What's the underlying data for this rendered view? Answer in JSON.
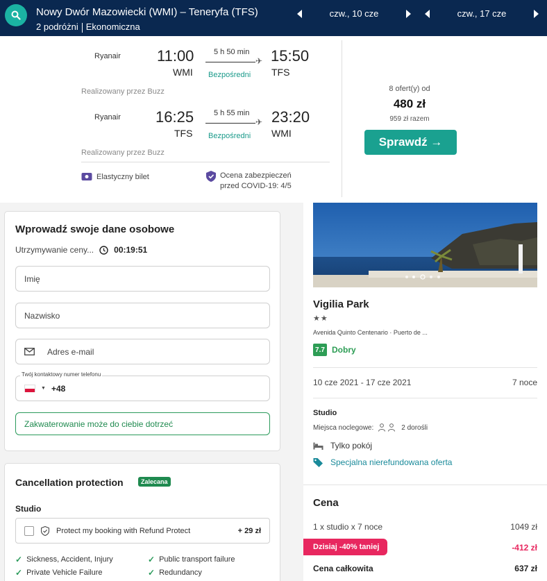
{
  "header": {
    "route": "Nowy Dwór Mazowiecki (WMI) – Teneryfa (TFS)",
    "travellers": "2 podróżni",
    "cabin": "Ekonomiczna",
    "depart_date": "czw., 10 cze",
    "return_date": "czw., 17 cze"
  },
  "flight": {
    "outbound": {
      "airline": "Ryanair",
      "dep_time": "11:00",
      "dep_code": "WMI",
      "duration": "5 h 50 min",
      "stops": "Bezpośredni",
      "arr_time": "15:50",
      "arr_code": "TFS",
      "operated": "Realizowany przez Buzz"
    },
    "inbound": {
      "airline": "Ryanair",
      "dep_time": "16:25",
      "dep_code": "TFS",
      "duration": "5 h 55 min",
      "stops": "Bezpośredni",
      "arr_time": "23:20",
      "arr_code": "WMI",
      "operated": "Realizowany przez Buzz"
    },
    "flexible": "Elastyczny bilet",
    "covid_line1": "Ocena zabezpieczeń",
    "covid_line2": "przed COVID-19: 4/5",
    "offers": "8 ofert(y) od",
    "price": "480 zł",
    "total": "959 zł razem",
    "cta": "Sprawdź →"
  },
  "form": {
    "title": "Wprowadź swoje dane osobowe",
    "hold_label": "Utrzymywanie ceny...",
    "timer": "00:19:51",
    "first_name_ph": "Imię",
    "last_name_ph": "Nazwisko",
    "email_ph": "Adres e-mail",
    "phone_label": "Twój kontaktowy numer telefonu",
    "phone_prefix": "+48",
    "notice": "Zakwaterowanie może do ciebie dotrzeć"
  },
  "cancellation": {
    "title": "Cancellation protection",
    "badge": "Zalecana",
    "room": "Studio",
    "option_label": "Protect my booking with Refund Protect",
    "option_price": "+ 29 zł",
    "benefits": [
      "Sickness, Accident, Injury",
      "Public transport failure",
      "Private Vehicle Failure",
      "Redundancy"
    ]
  },
  "hotel": {
    "name": "Vigilia Park",
    "stars": "★★",
    "address": "Avenida Quinto Centenario · Puerto de ...",
    "score": "7.7",
    "score_label": "Dobry",
    "dates": "10 cze 2021 - 17 cze 2021",
    "nights": "7 noce",
    "room_type": "Studio",
    "beds_label": "Miejsca noclegowe:",
    "guests": "2 dorośli",
    "room_only": "Tylko pokój",
    "special_offer": "Specjalna nierefundowana oferta",
    "price_title": "Cena",
    "price_line": "1 x studio  x 7 noce",
    "price_line_value": "1049 zł",
    "discount_label": "Dzisiaj -40% taniej",
    "discount_value": "-412 zł",
    "total_label": "Cena całkowita",
    "total_value": "637 zł"
  },
  "colors": {
    "header_bg": "#0a2850",
    "accent": "#1aa190",
    "discount": "#e8275f"
  }
}
